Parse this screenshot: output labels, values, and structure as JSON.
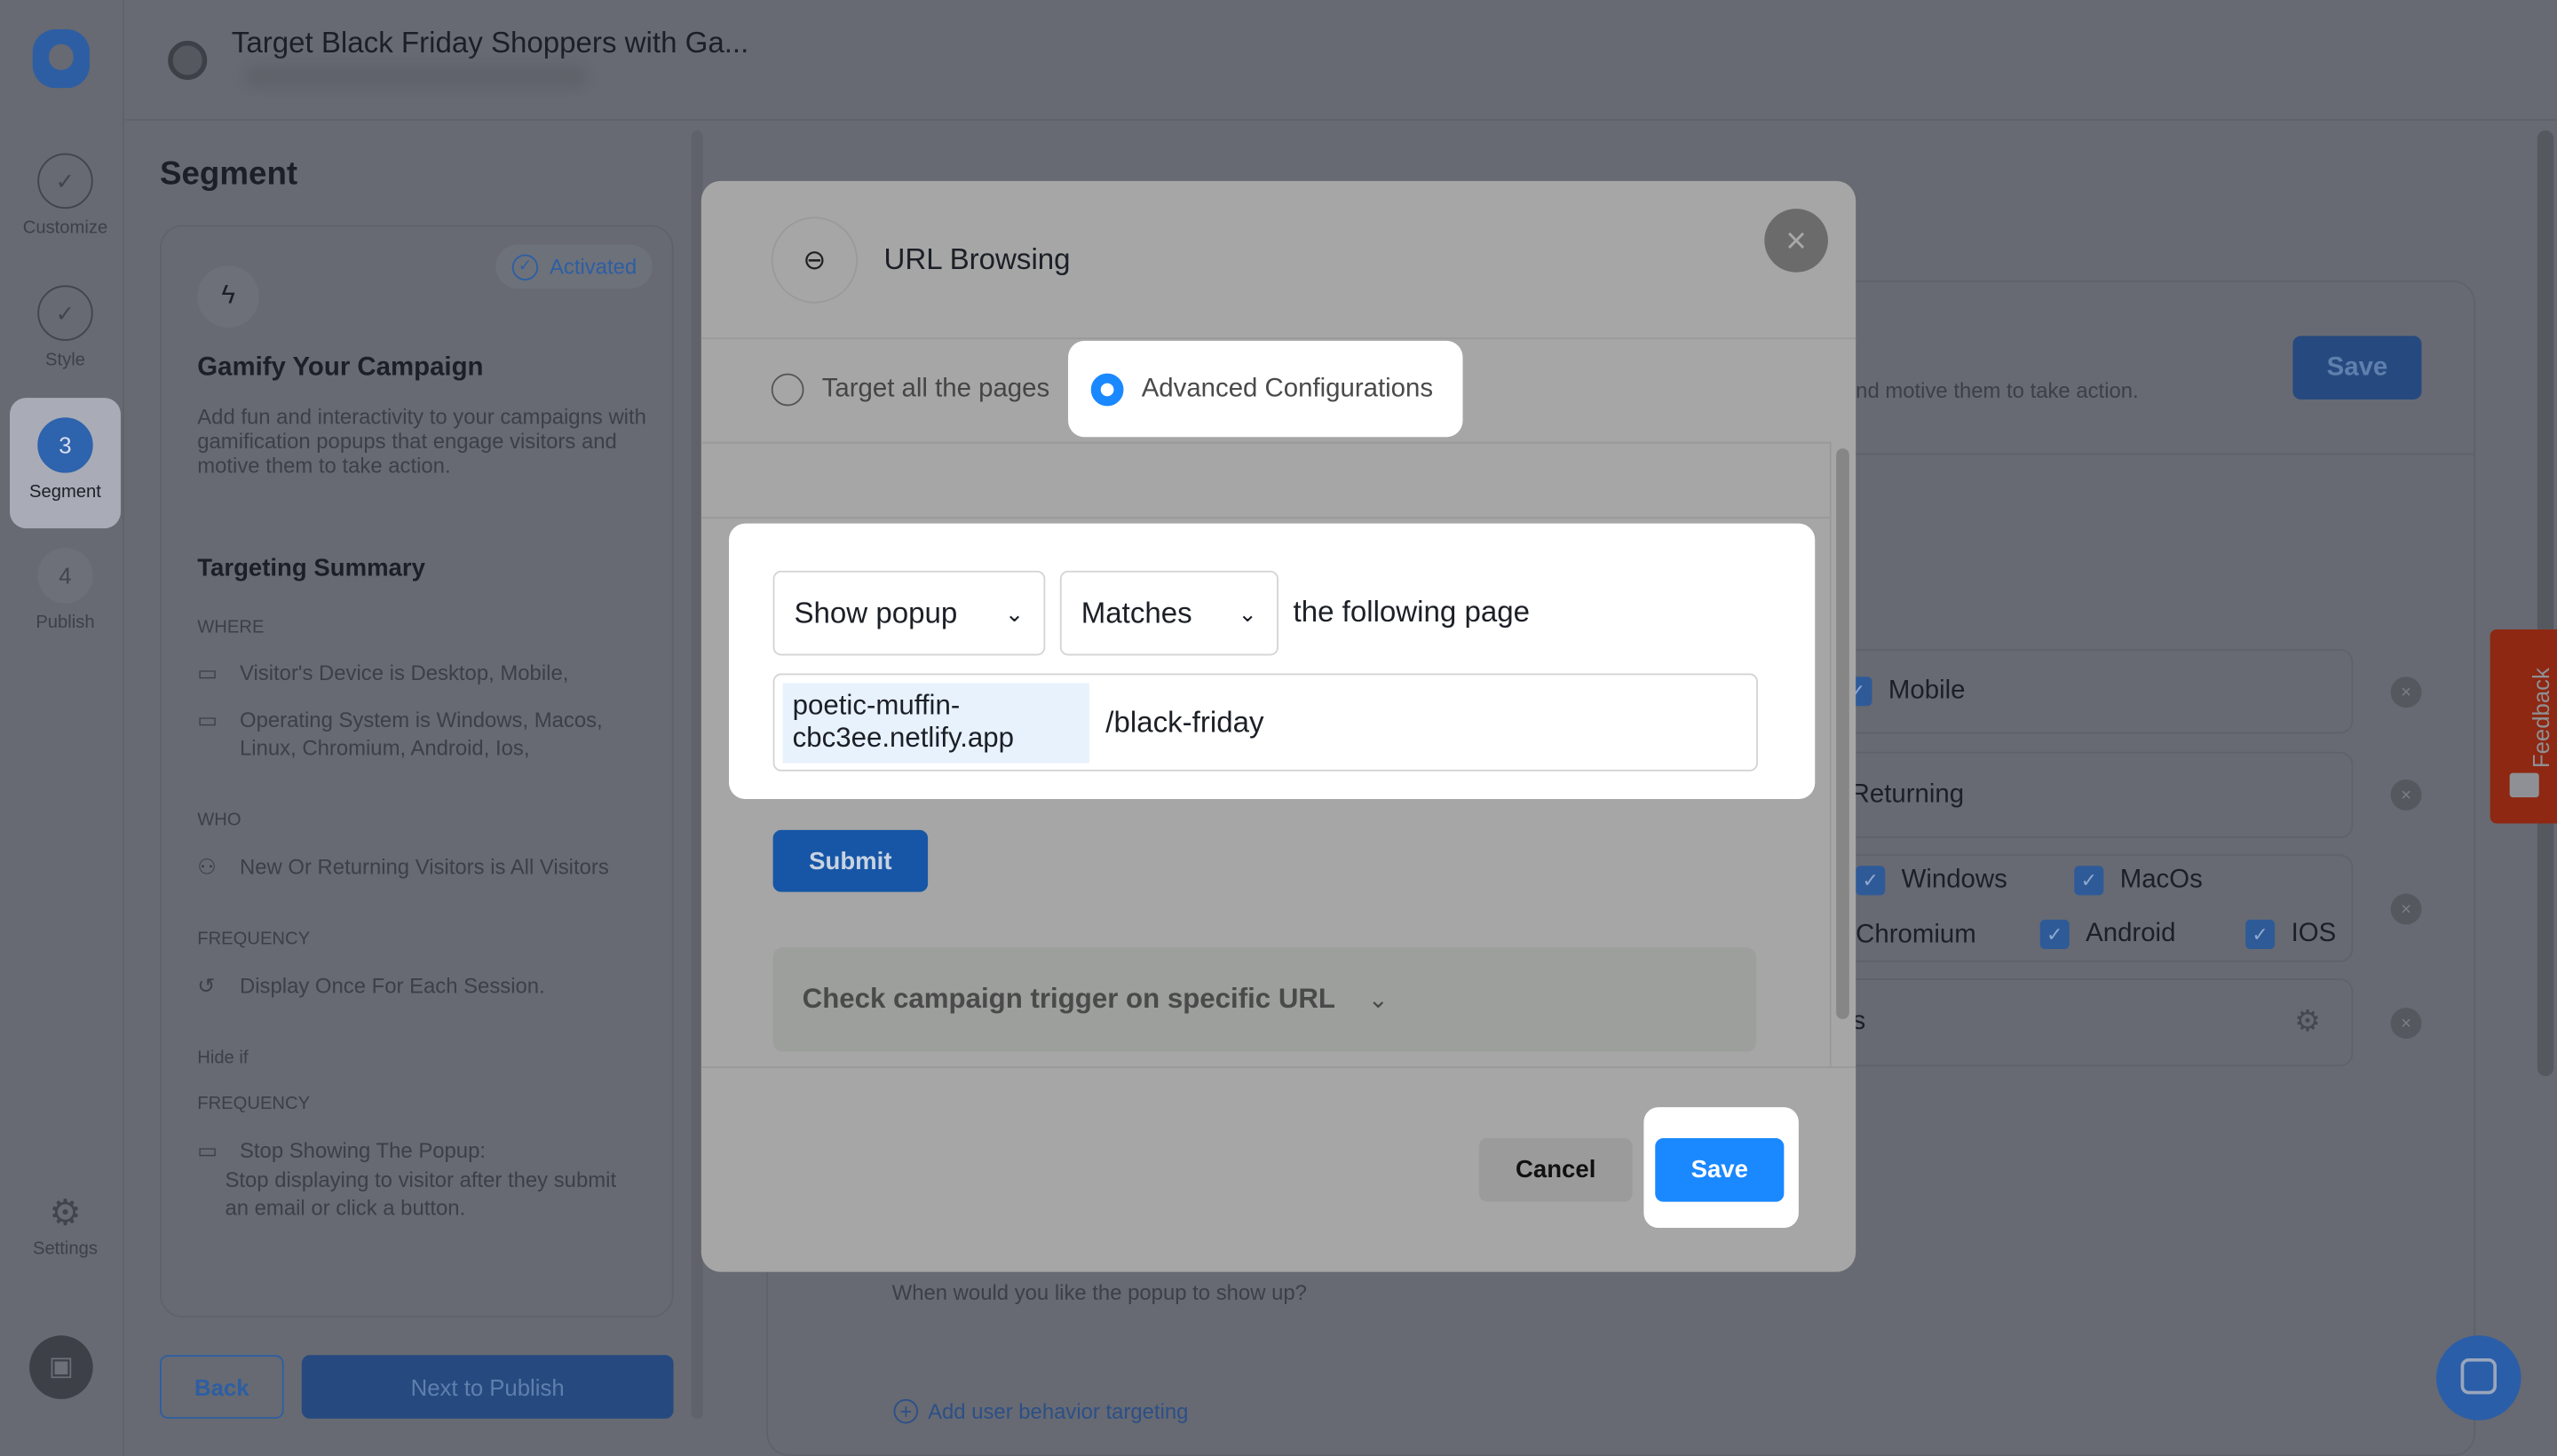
{
  "app": {
    "title": "Target Black Friday Shoppers with Ga..."
  },
  "nav": {
    "steps": [
      {
        "label": "Customize",
        "state": "done"
      },
      {
        "label": "Style",
        "state": "done"
      },
      {
        "label": "Segment",
        "number": "3",
        "state": "active"
      },
      {
        "label": "Publish",
        "number": "4",
        "state": "pending"
      }
    ],
    "settings_label": "Settings"
  },
  "segment": {
    "heading": "Segment",
    "card": {
      "badge": "Activated",
      "title": "Gamify Your Campaign",
      "description": "Add fun and interactivity to your campaigns with gamification popups that engage visitors and motive them to take action."
    },
    "summary": {
      "title": "Targeting Summary",
      "where_label": "WHERE",
      "device": "Visitor's Device is Desktop, Mobile,",
      "os": "Operating System is Windows, Macos, Linux, Chromium, Android, Ios,",
      "who_label": "WHO",
      "who": "New Or Returning Visitors is All Visitors",
      "freq_label": "FREQUENCY",
      "freq": "Display Once For Each Session.",
      "hide_if": "Hide if",
      "freq2_label": "FREQUENCY",
      "stop_title": "Stop Showing The Popup:",
      "stop_desc": "Stop displaying to visitor after they submit an email or click a button."
    },
    "back": "Back",
    "next": "Next to Publish"
  },
  "background": {
    "desc_partial": "nd motive them to take action.",
    "save": "Save",
    "mobile": "Mobile",
    "returning": "Returning",
    "os": [
      "Windows",
      "MacOs",
      "Chromium",
      "Android",
      "IOS"
    ],
    "partial_s": "s",
    "when": "When would you like the popup to show up?",
    "add_behavior": "Add user behavior targeting",
    "feedback": "Feedback"
  },
  "modal": {
    "title": "URL Browsing",
    "radio_all": "Target all the pages",
    "radio_adv": "Advanced Configurations",
    "selected": "Advanced Configurations",
    "action_select": "Show popup",
    "match_select": "Matches",
    "following": "the following page",
    "url_prefix": "poetic-muffin-cbc3ee.netlify.app",
    "url_path": "/black-friday",
    "submit": "Submit",
    "check_trigger": "Check campaign trigger on specific URL",
    "cancel": "Cancel",
    "save": "Save"
  },
  "colors": {
    "primary": "#1a88ff",
    "submit": "#1756a6",
    "feedback": "#8e2812"
  }
}
